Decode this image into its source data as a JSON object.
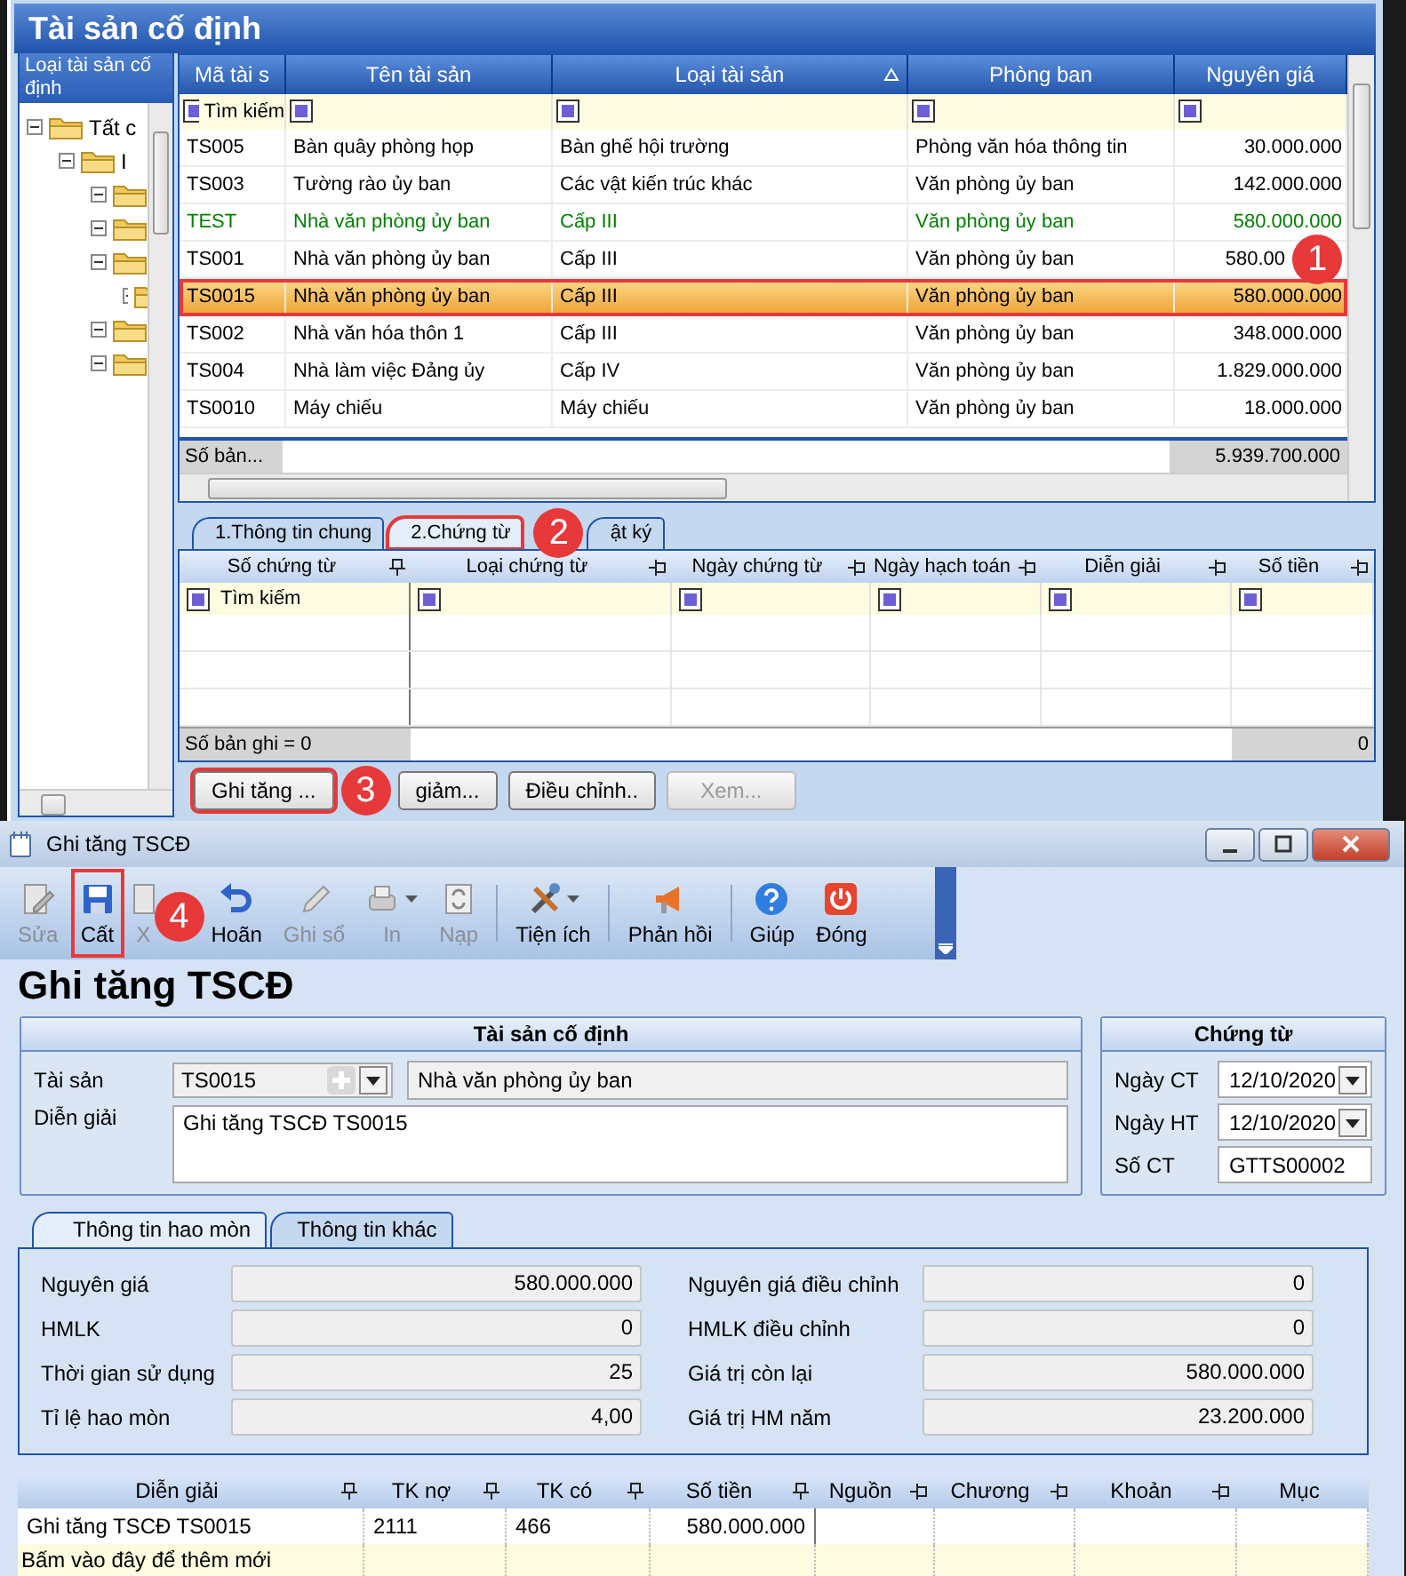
{
  "main_window": {
    "title": "Tài sản cố định"
  },
  "tree": {
    "header": "Loại tài sản cố định",
    "nodes": [
      {
        "label": "Tất c",
        "expanded": true,
        "children": [
          {
            "label": "I",
            "expanded": true,
            "children": [
              {
                "expanded": true
              },
              {
                "expanded": true
              },
              {
                "expanded": true,
                "children": [
                  {
                    "expanded": true
                  }
                ]
              },
              {
                "expanded": true
              },
              {
                "expanded": true
              }
            ]
          }
        ]
      }
    ]
  },
  "asset_grid": {
    "columns": [
      {
        "label": "Mã tài s"
      },
      {
        "label": "Tên tài sản"
      },
      {
        "label": "Loại tài sản",
        "sort_ascending": true
      },
      {
        "label": "Phòng ban"
      },
      {
        "label": "Nguyên giá"
      }
    ],
    "filter_text": "Tìm kiếm",
    "rows": [
      {
        "cells": [
          "TS005",
          "Bàn quây phòng họp",
          "Bàn ghế hội trường",
          "Phòng văn hóa thông tin",
          "30.000.000"
        ],
        "color": "#000000",
        "selected": false,
        "highlighted": false
      },
      {
        "cells": [
          "TS003",
          "Tường rào ủy ban",
          "Các vật kiến trúc khác",
          "Văn phòng ủy ban",
          "142.000.000"
        ],
        "color": "#000000",
        "selected": false,
        "highlighted": false
      },
      {
        "cells": [
          "TEST",
          "Nhà văn phòng ủy ban",
          "Cấp III",
          "Văn phòng ủy ban",
          "580.000.000"
        ],
        "color": "#008000",
        "selected": false,
        "highlighted": false
      },
      {
        "cells": [
          "TS001",
          "Nhà văn phòng ủy ban",
          "Cấp III",
          "Văn phòng ủy ban",
          "580.00"
        ],
        "color": "#000000",
        "selected": false,
        "highlighted": false,
        "badge": "1"
      },
      {
        "cells": [
          "TS0015",
          "Nhà văn phòng ủy ban",
          "Cấp III",
          "Văn phòng ủy ban",
          "580.000.000"
        ],
        "color": "#000000",
        "selected": true,
        "highlighted": true
      },
      {
        "cells": [
          "TS002",
          "Nhà văn hóa thôn 1",
          "Cấp III",
          "Văn phòng ủy ban",
          "348.000.000"
        ],
        "color": "#000000",
        "selected": false,
        "highlighted": false
      },
      {
        "cells": [
          "TS004",
          "Nhà làm việc Đảng ủy",
          "Cấp IV",
          "Văn phòng ủy ban",
          "1.829.000.000"
        ],
        "color": "#000000",
        "selected": false,
        "highlighted": false
      },
      {
        "cells": [
          "TS0010",
          "Máy chiếu",
          "Máy chiếu",
          "Văn phòng ủy ban",
          "18.000.000"
        ],
        "color": "#000000",
        "selected": false,
        "highlighted": false
      }
    ],
    "footer": {
      "label": "Số bản...",
      "total": "5.939.700.000"
    }
  },
  "detail_tabs": [
    {
      "label": "1.Thông tin chung",
      "selected": false,
      "highlighted": false
    },
    {
      "label": "2.Chứng từ",
      "selected": true,
      "highlighted": true,
      "badge": "2"
    },
    {
      "label": "ật ký",
      "selected": false,
      "highlighted": false
    }
  ],
  "voucher_grid": {
    "columns": [
      {
        "label": "Số chứng từ",
        "pinned": true
      },
      {
        "label": "Loại chứng từ",
        "pinned": false
      },
      {
        "label": "Ngày chứng từ",
        "pinned": false
      },
      {
        "label": "Ngày hạch toán",
        "pinned": false
      },
      {
        "label": "Diễn giải",
        "pinned": false
      },
      {
        "label": "Số tiền",
        "pinned": false
      }
    ],
    "filter_text": "Tìm kiếm",
    "footer": {
      "count": "Số bản ghi = 0",
      "total": "0"
    }
  },
  "actions": [
    {
      "label": "Ghi tăng ...",
      "disabled": false,
      "highlighted": true,
      "badge": "3"
    },
    {
      "label": "giảm...",
      "disabled": false,
      "highlighted": false
    },
    {
      "label": "Điều chỉnh..",
      "disabled": false,
      "highlighted": false
    },
    {
      "label": "Xem...",
      "disabled": true,
      "highlighted": false
    }
  ],
  "dialog": {
    "title": "Ghi tăng TSCĐ",
    "toolbar": [
      {
        "kind": "edit",
        "label": "Sửa",
        "disabled": true,
        "highlighted": false
      },
      {
        "kind": "save",
        "label": "Cất",
        "disabled": false,
        "highlighted": true
      },
      {
        "kind": "delete",
        "label": "X",
        "disabled": true,
        "highlighted": false,
        "badge": "4"
      },
      {
        "kind": "undo",
        "label": "Hoãn",
        "disabled": false,
        "highlighted": false
      },
      {
        "kind": "post",
        "label": "Ghi sổ",
        "disabled": true,
        "highlighted": false
      },
      {
        "kind": "print",
        "label": "In",
        "disabled": true,
        "highlighted": false,
        "dropdown": true
      },
      {
        "kind": "reload",
        "label": "Nạp",
        "disabled": true,
        "highlighted": false,
        "separator": true
      },
      {
        "kind": "tools",
        "label": "Tiện ích",
        "disabled": false,
        "highlighted": false,
        "dropdown": true,
        "separator": true
      },
      {
        "kind": "feedback",
        "label": "Phản hồi",
        "disabled": false,
        "highlighted": false,
        "separator": true
      },
      {
        "kind": "help",
        "label": "Giúp",
        "disabled": false,
        "highlighted": false
      },
      {
        "kind": "close",
        "label": "Đóng",
        "disabled": false,
        "highlighted": false
      }
    ],
    "heading": "Ghi tăng TSCĐ",
    "asset_group": {
      "title": "Tài sản cố định",
      "asset_label": "Tài sản",
      "asset_code": "TS0015",
      "asset_name": "Nhà văn phòng ủy ban",
      "desc_label": "Diễn giải",
      "desc": "Ghi tăng TSCĐ TS0015"
    },
    "voucher_group": {
      "title": "Chứng từ",
      "fields": [
        {
          "label": "Ngày CT",
          "value": "12/10/2020",
          "kind": "date"
        },
        {
          "label": "Ngày HT",
          "value": "12/10/2020",
          "kind": "date"
        },
        {
          "label": "Số CT",
          "value": "GTTS00002",
          "kind": "text"
        }
      ]
    },
    "tabs": [
      {
        "label": "Thông tin hao mòn",
        "selected": true
      },
      {
        "label": "Thông tin khác",
        "selected": false
      }
    ],
    "depreciation": [
      {
        "label": "Nguyên giá",
        "value": "580.000.000"
      },
      {
        "label": "Nguyên giá điều chỉnh",
        "value": "0"
      },
      {
        "label": "HMLK",
        "value": "0"
      },
      {
        "label": "HMLK điều chỉnh",
        "value": "0"
      },
      {
        "label": "Thời gian sử dụng",
        "value": "25"
      },
      {
        "label": "Giá trị còn lại",
        "value": "580.000.000"
      },
      {
        "label": "Tỉ lệ hao mòn",
        "value": "4,00"
      },
      {
        "label": "Giá trị HM năm",
        "value": "23.200.000"
      }
    ],
    "entries": {
      "columns": [
        {
          "label": "Diễn giải",
          "pinned": true
        },
        {
          "label": "TK nợ",
          "pinned": true
        },
        {
          "label": "TK có",
          "pinned": true
        },
        {
          "label": "Số tiền",
          "pinned": true
        },
        {
          "label": "Nguồn",
          "pinned": false
        },
        {
          "label": "Chương",
          "pinned": false
        },
        {
          "label": "Khoản",
          "pinned": false
        },
        {
          "label": "Mục"
        }
      ],
      "rows": [
        {
          "cells": [
            "Ghi tăng TSCĐ TS0015",
            "2111",
            "466",
            "580.000.000"
          ]
        }
      ],
      "new_row": "Bấm vào đây để thêm mới"
    }
  }
}
